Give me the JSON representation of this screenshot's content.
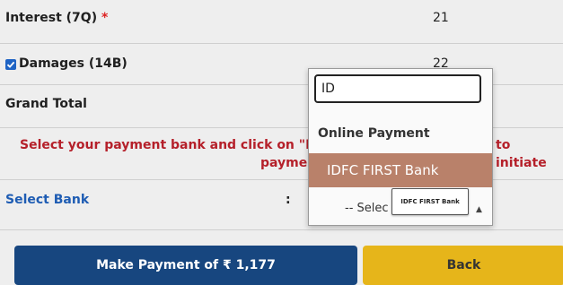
{
  "rows": {
    "interest": {
      "label": "Interest (7Q)",
      "required_mark": "*",
      "value": "21"
    },
    "damages": {
      "label": "Damages (14B)",
      "value": "22",
      "checked": true
    },
    "grand_total": {
      "label": "Grand Total"
    }
  },
  "notice": {
    "line1_left": "Select your payment bank and click on \"Ma",
    "line1_right": "to initiate",
    "line2": "payme"
  },
  "select_bank": {
    "label": "Select Bank",
    "colon": ":"
  },
  "dropdown": {
    "search_value": "ID",
    "group_label": "Online Payment",
    "highlighted_option": "IDFC FIRST Bank",
    "select_placeholder": "-- Selec",
    "tooltip": "IDFC FIRST Bank"
  },
  "buttons": {
    "make_payment": "Make Payment of ₹ 1,177",
    "back": "Back"
  },
  "colors": {
    "primary_button": "#17467f",
    "back_button": "#e6b51a",
    "highlight_option": "#b9816a",
    "notice_text": "#b5202a",
    "link_text": "#1e5cb3"
  }
}
